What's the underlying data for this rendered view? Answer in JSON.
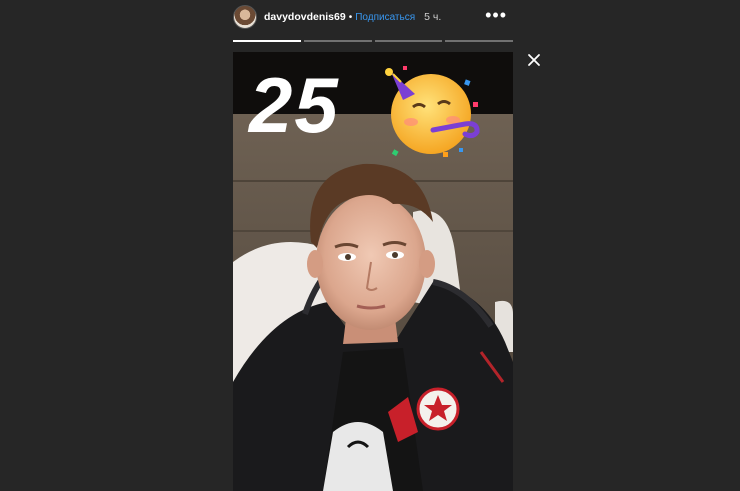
{
  "header": {
    "username": "davydovdenis69",
    "separator": "•",
    "follow_label": "Подписаться",
    "time_ago": "5 ч.",
    "more_label": "•••"
  },
  "progress": {
    "segments": [
      1.0,
      0.0,
      0.0,
      0.0
    ]
  },
  "story": {
    "caption": "25",
    "sticker": "party-face-emoji"
  },
  "colors": {
    "background": "#262626",
    "link": "#3897f0",
    "text": "#ffffff"
  }
}
